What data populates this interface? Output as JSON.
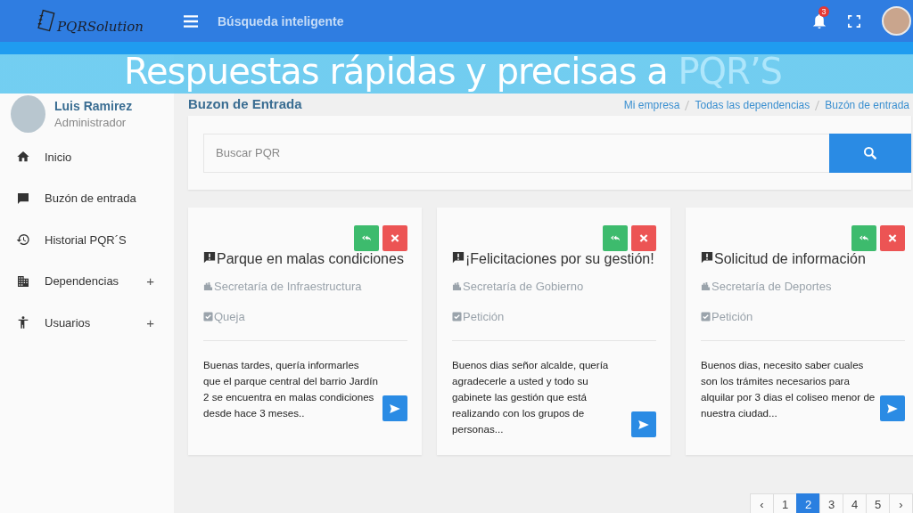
{
  "navbar": {
    "logo": "PQRSolution",
    "search_label": "Búsqueda inteligente",
    "notifications": "3"
  },
  "banner": {
    "text": "Respuestas rápidas y precisas a ",
    "highlight": "PQR’S"
  },
  "user": {
    "name": "Luis Ramirez",
    "role": "Administrador"
  },
  "sidebar": {
    "items": [
      {
        "kind": "home",
        "label": "Inicio",
        "selected": false
      },
      {
        "kind": "chat",
        "label": "Buzón de entrada",
        "selected": false
      },
      {
        "kind": "history",
        "label": "Historial PQR´S",
        "selected": false
      },
      {
        "kind": "building",
        "label": "Dependencias",
        "toggle": "+",
        "selected": false
      },
      {
        "kind": "person",
        "label": "Usuarios",
        "toggle": "+",
        "selected": false
      }
    ]
  },
  "page": {
    "title": "Buzon de Entrada",
    "breadcrumbs": [
      "Mi empresa",
      "Todas las dependencias",
      "Buzón de entrada"
    ]
  },
  "search": {
    "placeholder": "Buscar PQR"
  },
  "cards": [
    {
      "title": "Parque en malas condiciones",
      "department": "Secretaría de Infraestructura",
      "type": "Queja",
      "body": "Buenas tardes, quería informarles que el parque central del barrio Jardín 2 se encuentra en malas condiciones desde hace 3 meses.."
    },
    {
      "title": "¡Felicitaciones por su gestión!",
      "department": "Secretaría de Gobierno",
      "type": "Petición",
      "body": "Buenos dias señor alcalde, quería agradecerle a usted y todo su gabinete las gestión que está realizando con los grupos de personas..."
    },
    {
      "title": "Solicitud de información",
      "department": "Secretaría de Deportes",
      "type": "Petición",
      "body": "Buenos dias, necesito saber cuales son los trámites necesarios para alquilar por 3 dias el coliseo menor de nuestra ciudad..."
    }
  ],
  "pagination": {
    "prev": "‹",
    "next": "›",
    "pages": [
      {
        "label": "1",
        "selected": false
      },
      {
        "label": "2",
        "selected": true
      },
      {
        "label": "3",
        "selected": false
      },
      {
        "label": "4",
        "selected": false
      },
      {
        "label": "5",
        "selected": false
      }
    ]
  }
}
